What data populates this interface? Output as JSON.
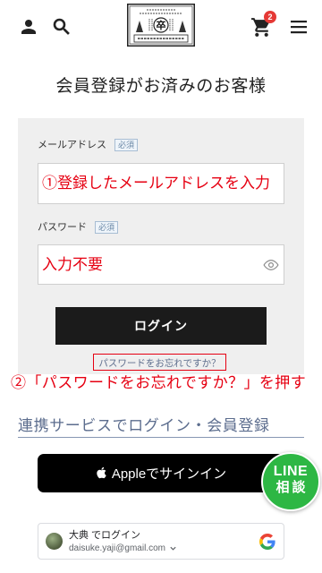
{
  "header": {
    "logo_mark": "卒",
    "cart_count": "2",
    "icons": {
      "account": "user-icon",
      "search": "search-icon",
      "cart": "cart-icon",
      "menu": "hamburger-menu-icon"
    }
  },
  "login": {
    "title": "会員登録がお済みのお客様",
    "email": {
      "label": "メールアドレス",
      "required": "必須",
      "value": "①登録したメールアドレスを入力"
    },
    "password": {
      "label": "パスワード",
      "required": "必須",
      "value": "入力不要",
      "icon": "eye-icon"
    },
    "submit_label": "ログイン",
    "forgot_link": "パスワードをお忘れですか？"
  },
  "instruction": "②「パスワードをお忘れですか？」を押す",
  "social_login": {
    "heading": "連携サービスでログイン・会員登録",
    "apple": {
      "label": "Appleでサインイン",
      "icon": "apple-icon"
    },
    "google": {
      "name_line": "大典 でログイン",
      "email": "daisuke.yaji@gmail.com",
      "icon": "google-g-icon"
    }
  },
  "line_chat": {
    "line1": "LINE",
    "line2": "相談"
  },
  "colors": {
    "annotation_red": "#e60012",
    "line_green": "#2db744",
    "cart_badge": "#e53935",
    "login_button": "#1b1b1b",
    "panel_bg": "#efefef"
  }
}
